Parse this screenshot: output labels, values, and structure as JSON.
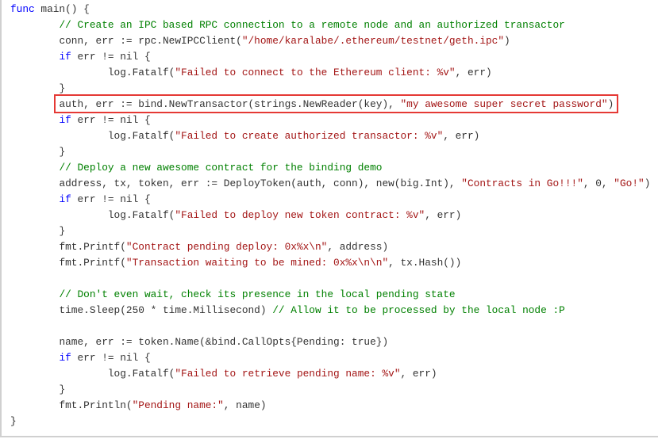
{
  "colors": {
    "keyword": "#0000ff",
    "comment": "#008000",
    "string": "#a31515",
    "text": "#333333",
    "highlight": "#e53935"
  },
  "highlighted_line": 6,
  "lines": [
    [
      [
        "kw",
        "func"
      ],
      [
        "tx",
        " main() {"
      ]
    ],
    [
      [
        "tx",
        "\t"
      ],
      [
        "cm",
        "// Create an IPC based RPC connection to a remote node and an authorized transactor"
      ]
    ],
    [
      [
        "tx",
        "\tconn, err := rpc.NewIPCClient("
      ],
      [
        "st",
        "\"/home/karalabe/.ethereum/testnet/geth.ipc\""
      ],
      [
        "tx",
        ")"
      ]
    ],
    [
      [
        "tx",
        "\t"
      ],
      [
        "kw",
        "if"
      ],
      [
        "tx",
        " err != nil {"
      ]
    ],
    [
      [
        "tx",
        "\t\tlog.Fatalf("
      ],
      [
        "st",
        "\"Failed to connect to the Ethereum client: %v\""
      ],
      [
        "tx",
        ", err)"
      ]
    ],
    [
      [
        "tx",
        "\t}"
      ]
    ],
    [
      [
        "tx",
        "\tauth, err := bind.NewTransactor(strings.NewReader(key), "
      ],
      [
        "st",
        "\"my awesome super secret password\""
      ],
      [
        "tx",
        ")"
      ]
    ],
    [
      [
        "tx",
        "\t"
      ],
      [
        "kw",
        "if"
      ],
      [
        "tx",
        " err != nil {"
      ]
    ],
    [
      [
        "tx",
        "\t\tlog.Fatalf("
      ],
      [
        "st",
        "\"Failed to create authorized transactor: %v\""
      ],
      [
        "tx",
        ", err)"
      ]
    ],
    [
      [
        "tx",
        "\t}"
      ]
    ],
    [
      [
        "tx",
        "\t"
      ],
      [
        "cm",
        "// Deploy a new awesome contract for the binding demo"
      ]
    ],
    [
      [
        "tx",
        "\taddress, tx, token, err := DeployToken(auth, conn), new(big.Int), "
      ],
      [
        "st",
        "\"Contracts in Go!!!\""
      ],
      [
        "tx",
        ", 0, "
      ],
      [
        "st",
        "\"Go!\""
      ],
      [
        "tx",
        ")"
      ]
    ],
    [
      [
        "tx",
        "\t"
      ],
      [
        "kw",
        "if"
      ],
      [
        "tx",
        " err != nil {"
      ]
    ],
    [
      [
        "tx",
        "\t\tlog.Fatalf("
      ],
      [
        "st",
        "\"Failed to deploy new token contract: %v\""
      ],
      [
        "tx",
        ", err)"
      ]
    ],
    [
      [
        "tx",
        "\t}"
      ]
    ],
    [
      [
        "tx",
        "\tfmt.Printf("
      ],
      [
        "st",
        "\"Contract pending deploy: 0x%x\\n\""
      ],
      [
        "tx",
        ", address)"
      ]
    ],
    [
      [
        "tx",
        "\tfmt.Printf("
      ],
      [
        "st",
        "\"Transaction waiting to be mined: 0x%x\\n\\n\""
      ],
      [
        "tx",
        ", tx.Hash())"
      ]
    ],
    [
      [
        "tx",
        ""
      ]
    ],
    [
      [
        "tx",
        "\t"
      ],
      [
        "cm",
        "// Don't even wait, check its presence in the local pending state"
      ]
    ],
    [
      [
        "tx",
        "\ttime.Sleep(250 * time.Millisecond) "
      ],
      [
        "cm",
        "// Allow it to be processed by the local node :P"
      ]
    ],
    [
      [
        "tx",
        ""
      ]
    ],
    [
      [
        "tx",
        "\tname, err := token.Name(&bind.CallOpts{Pending: true})"
      ]
    ],
    [
      [
        "tx",
        "\t"
      ],
      [
        "kw",
        "if"
      ],
      [
        "tx",
        " err != nil {"
      ]
    ],
    [
      [
        "tx",
        "\t\tlog.Fatalf("
      ],
      [
        "st",
        "\"Failed to retrieve pending name: %v\""
      ],
      [
        "tx",
        ", err)"
      ]
    ],
    [
      [
        "tx",
        "\t}"
      ]
    ],
    [
      [
        "tx",
        "\tfmt.Println("
      ],
      [
        "st",
        "\"Pending name:\""
      ],
      [
        "tx",
        ", name)"
      ]
    ],
    [
      [
        "tx",
        "}"
      ]
    ]
  ]
}
